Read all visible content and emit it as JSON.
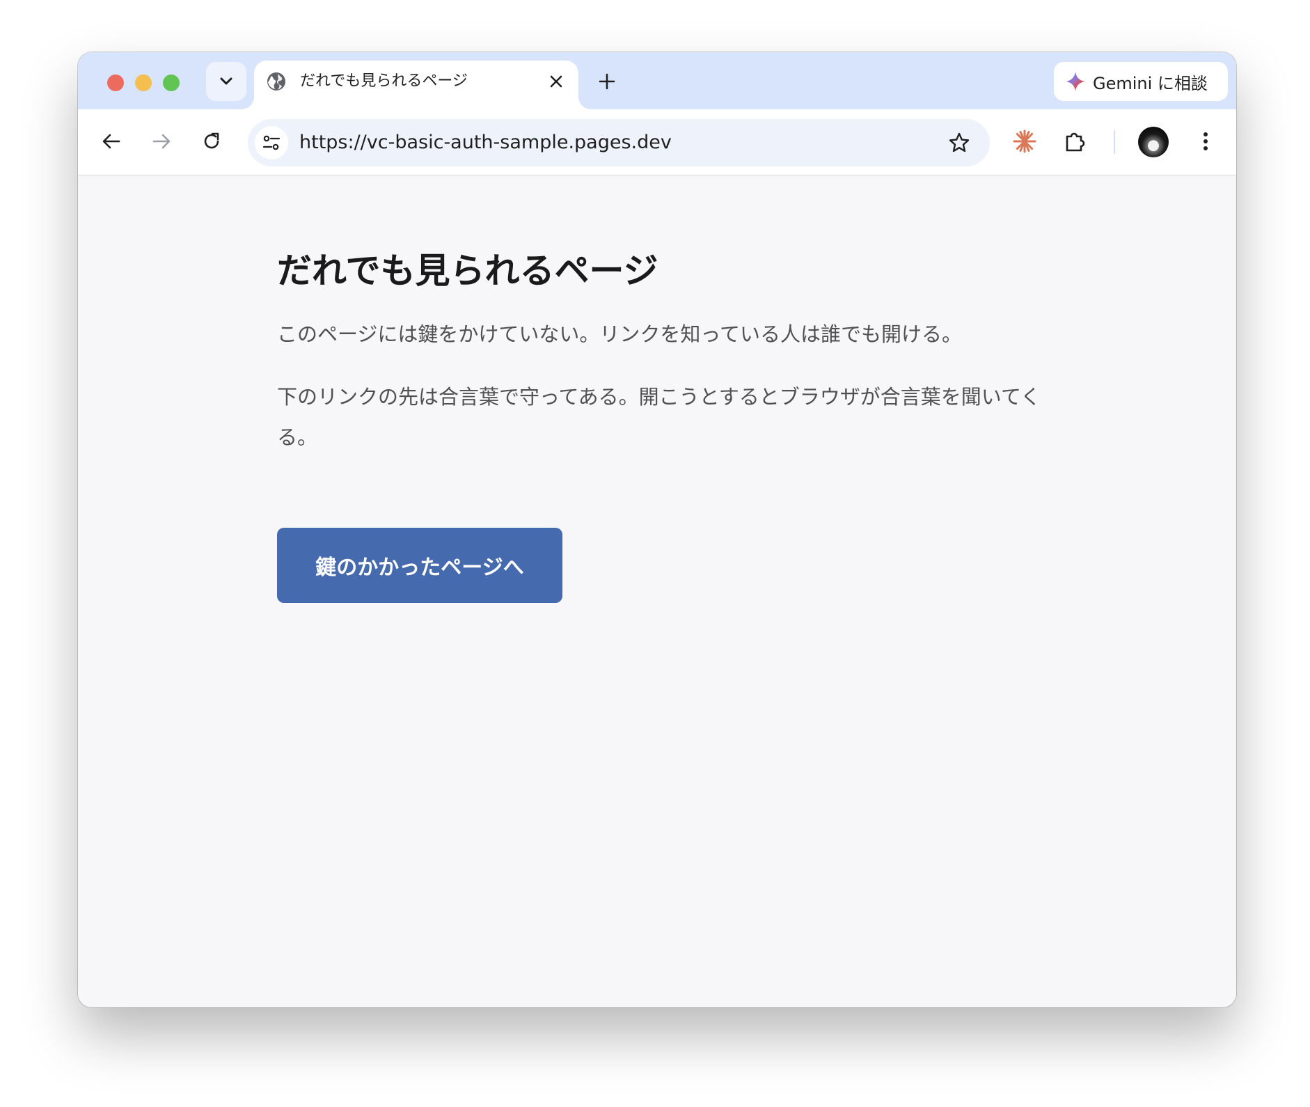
{
  "browser": {
    "tab": {
      "title": "だれでも見られるページ",
      "favicon": "globe-icon"
    },
    "gemini_button": {
      "label": "Gemini に相談"
    },
    "address_bar": {
      "url": "https://vc-basic-auth-sample.pages.dev"
    },
    "toolbar_icons": [
      "back-arrow-icon",
      "forward-arrow-icon",
      "reload-icon",
      "site-info-icon",
      "bookmark-star-icon",
      "claude-extension-icon",
      "extensions-puzzle-icon",
      "profile-avatar",
      "more-menu-icon"
    ],
    "colors": {
      "tabstrip": "#d8e3fc",
      "omnibox": "#edf2fb",
      "accent_extension": "#d97757"
    }
  },
  "page": {
    "title": "だれでも見られるページ",
    "paragraph1": "このページには鍵をかけていない。リンクを知っている人は誰でも開ける。",
    "paragraph2": "下のリンクの先は合言葉で守ってある。開こうとするとブラウザが合言葉を聞いてくる。",
    "button_label": "鍵のかかったページへ",
    "colors": {
      "background": "#f7f7f9",
      "button": "#456aad",
      "title_text": "#1a1a1a",
      "body_text": "#505050"
    }
  }
}
